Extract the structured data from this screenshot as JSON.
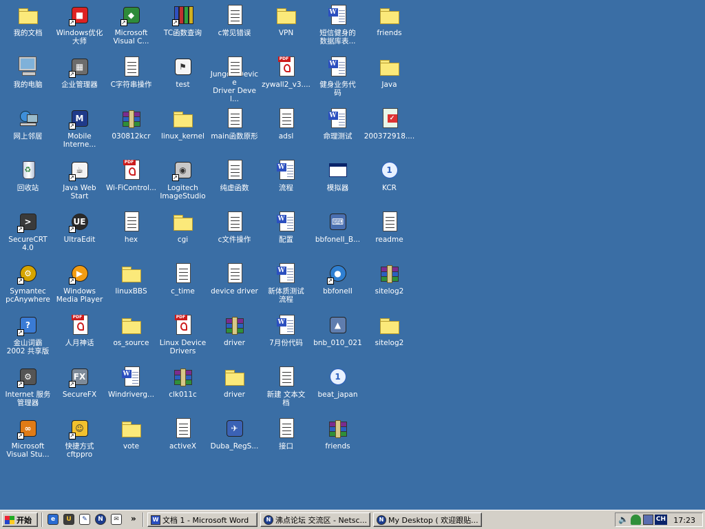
{
  "desktop": {
    "background": "#3a6ea5",
    "icons": [
      {
        "label": "我的文档",
        "icon": "my-documents-icon"
      },
      {
        "label": "我的电脑",
        "icon": "my-computer-icon"
      },
      {
        "label": "网上邻居",
        "icon": "network-neighborhood-icon"
      },
      {
        "label": "回收站",
        "icon": "recycle-bin-icon"
      },
      {
        "label": "SecureCRT\n4.0",
        "icon": "securecrt-icon"
      },
      {
        "label": "Symantec\npcAnywhere",
        "icon": "pcanywhere-icon"
      },
      {
        "label": "金山词霸\n2002 共享版",
        "icon": "kingsoft-dictionary-icon"
      },
      {
        "label": "Internet 服务\n管理器",
        "icon": "iis-manager-icon"
      },
      {
        "label": "Microsoft\nVisual Stu...",
        "icon": "visual-studio-icon"
      },
      {
        "label": "Windows优化\n大师",
        "icon": "windows-optimizer-icon"
      },
      {
        "label": "企业管理器",
        "icon": "enterprise-manager-icon"
      },
      {
        "label": "Mobile\nInterne...",
        "icon": "mobile-internet-icon"
      },
      {
        "label": "Java Web\nStart",
        "icon": "java-web-start-icon"
      },
      {
        "label": "UltraEdit",
        "icon": "ultraedit-icon"
      },
      {
        "label": "Windows\nMedia Player",
        "icon": "media-player-icon"
      },
      {
        "label": "人月神话",
        "icon": "pdf-icon"
      },
      {
        "label": "SecureFX",
        "icon": "securefx-icon"
      },
      {
        "label": "快捷方式\ncftppro",
        "icon": "cftppro-icon"
      },
      {
        "label": "Microsoft\nVisual C...",
        "icon": "visual-c-icon"
      },
      {
        "label": "C字符串操作",
        "icon": "text-file-icon"
      },
      {
        "label": "030812kcr",
        "icon": "rar-archive-icon"
      },
      {
        "label": "Wi-FiControl...",
        "icon": "pdf-icon"
      },
      {
        "label": "hex",
        "icon": "text-file-icon"
      },
      {
        "label": "linuxBBS",
        "icon": "folder-icon"
      },
      {
        "label": "os_source",
        "icon": "folder-icon"
      },
      {
        "label": "Windriverg...",
        "icon": "word-doc-icon"
      },
      {
        "label": "vote",
        "icon": "folder-icon"
      },
      {
        "label": "TC函数查询",
        "icon": "books-icon"
      },
      {
        "label": "test",
        "icon": "installer-icon"
      },
      {
        "label": "linux_kernel",
        "icon": "folder-icon"
      },
      {
        "label": "Logitech\nImageStudio",
        "icon": "logitech-icon"
      },
      {
        "label": "cgi",
        "icon": "folder-icon"
      },
      {
        "label": "c_time",
        "icon": "text-file-icon"
      },
      {
        "label": "Linux Device\nDrivers",
        "icon": "pdf-icon"
      },
      {
        "label": "clk011c",
        "icon": "rar-archive-icon"
      },
      {
        "label": "activeX",
        "icon": "text-file-icon"
      },
      {
        "label": "c常见错误",
        "icon": "text-file-icon"
      },
      {
        "label": "Jungo - Device\nDriver Devel...",
        "icon": "text-file-icon"
      },
      {
        "label": "main函数原形",
        "icon": "text-file-icon"
      },
      {
        "label": "纯虚函数",
        "icon": "text-file-icon"
      },
      {
        "label": "c文件操作",
        "icon": "text-file-icon"
      },
      {
        "label": "device driver",
        "icon": "text-file-icon"
      },
      {
        "label": "driver",
        "icon": "rar-archive-icon"
      },
      {
        "label": "driver",
        "icon": "folder-icon"
      },
      {
        "label": "Duba_RegS...",
        "icon": "duba-icon"
      },
      {
        "label": "VPN",
        "icon": "folder-icon"
      },
      {
        "label": "zywall2_v3....",
        "icon": "pdf-icon"
      },
      {
        "label": "adsl",
        "icon": "text-file-icon"
      },
      {
        "label": "流程",
        "icon": "word-doc-icon"
      },
      {
        "label": "配置",
        "icon": "word-doc-icon"
      },
      {
        "label": "新体质测试\n流程",
        "icon": "word-doc-icon"
      },
      {
        "label": "7月份代码",
        "icon": "word-doc-icon"
      },
      {
        "label": "新建 文本文\n档",
        "icon": "text-file-icon"
      },
      {
        "label": "接口",
        "icon": "text-file-icon"
      },
      {
        "label": "短信健身的\n数据库表...",
        "icon": "word-doc-icon"
      },
      {
        "label": "健身业务代\n码",
        "icon": "word-doc-icon"
      },
      {
        "label": "命理测试",
        "icon": "word-doc-icon"
      },
      {
        "label": "模拟器",
        "icon": "window-icon"
      },
      {
        "label": "bbfoneII_B...",
        "icon": "bbfone-installer-icon"
      },
      {
        "label": "bbfoneII",
        "icon": "bbfone-globe-icon"
      },
      {
        "label": "bnb_010_021",
        "icon": "bnb-icon"
      },
      {
        "label": "beat_japan",
        "icon": "kcr-icon"
      },
      {
        "label": "friends",
        "icon": "rar-archive-icon"
      },
      {
        "label": "friends",
        "icon": "folder-icon"
      },
      {
        "label": "Java",
        "icon": "folder-icon"
      },
      {
        "label": "200372918....",
        "icon": "image-file-icon"
      },
      {
        "label": "KCR",
        "icon": "kcr-icon"
      },
      {
        "label": "readme",
        "icon": "text-file-icon"
      },
      {
        "label": "sitelog2",
        "icon": "rar-archive-icon"
      },
      {
        "label": "sitelog2",
        "icon": "folder-icon"
      }
    ]
  },
  "taskbar": {
    "start_label": "开始",
    "quick_launch": [
      "ie-icon",
      "ultraedit-icon",
      "notepad-icon",
      "netscape-icon",
      "outlook-icon"
    ],
    "more_label": "»",
    "tasks": [
      {
        "label": "文档 1 - Microsoft Word",
        "icon": "word-icon"
      },
      {
        "label": "沸点论坛 交流区 - Netsc...",
        "icon": "netscape-icon"
      },
      {
        "label": "My Desktop ( 欢迎跟贴...",
        "icon": "netscape-icon"
      }
    ],
    "tray": {
      "icons": [
        "volume-icon",
        "network-icon",
        "ime-icon"
      ],
      "ime_label": "CH",
      "clock": "17:23"
    }
  }
}
